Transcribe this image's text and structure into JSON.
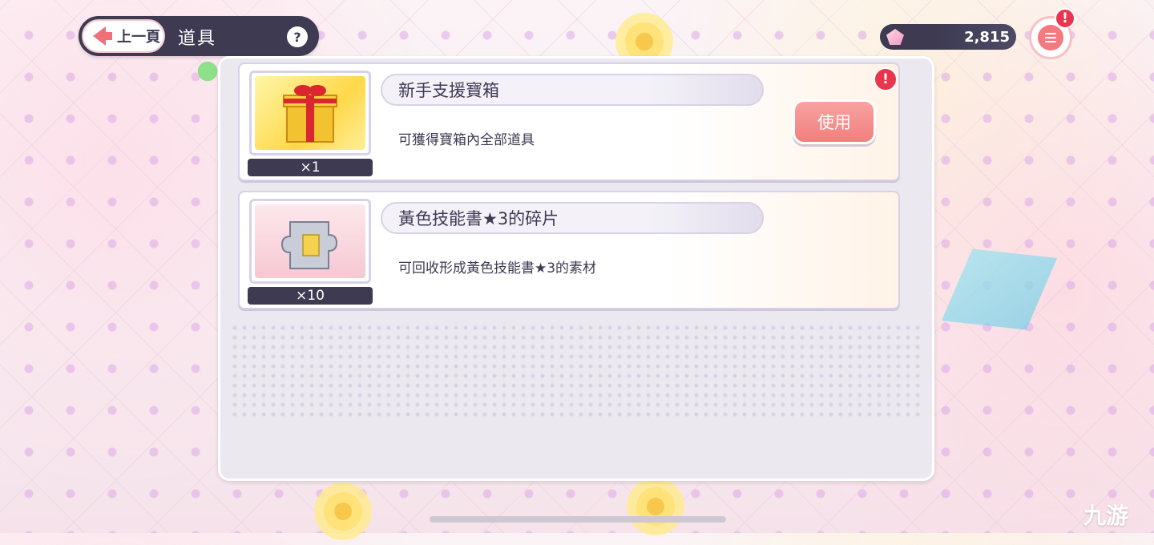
{
  "header": {
    "back_label": "上一頁",
    "title": "道具",
    "help_label": "?"
  },
  "currency": {
    "value": "2,815",
    "icon": "gem-icon"
  },
  "menu": {
    "icon": "menu-icon",
    "alert": "!"
  },
  "items": [
    {
      "name": "新手支援寶箱",
      "description": "可獲得寶箱內全部道具",
      "quantity": "×1",
      "icon": "gift-box-icon",
      "use_label": "使用",
      "alert": "!"
    },
    {
      "name": "黃色技能書★3的碎片",
      "description": "可回收形成黃色技能書★3的素材",
      "quantity": "×10",
      "icon": "puzzle-piece-icon"
    }
  ],
  "watermark": "九游",
  "colors": {
    "dark": "#3d3a52",
    "accent": "#f27f7d",
    "alert": "#e8364f"
  }
}
